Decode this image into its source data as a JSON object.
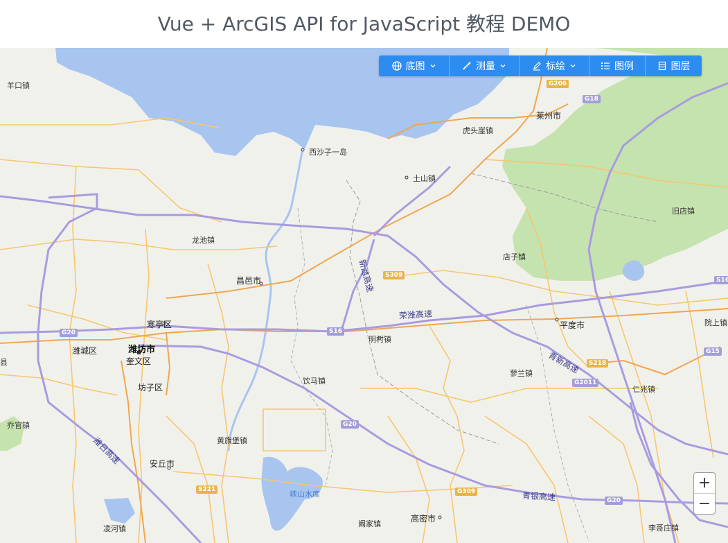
{
  "header": {
    "title": "Vue + ArcGIS API for JavaScript 教程 DEMO"
  },
  "toolbar": {
    "items": [
      {
        "label": "底图",
        "icon": "globe-icon",
        "dropdown": true
      },
      {
        "label": "测量",
        "icon": "ruler-icon",
        "dropdown": true
      },
      {
        "label": "标绘",
        "icon": "pen-icon",
        "dropdown": true
      },
      {
        "label": "图例",
        "icon": "list-icon",
        "dropdown": false
      },
      {
        "label": "图层",
        "icon": "layers-icon",
        "dropdown": false
      }
    ],
    "color": "#2d8cf0"
  },
  "zoom": {
    "in": "+",
    "out": "−"
  },
  "map": {
    "colors": {
      "land": "#f1f1ec",
      "water": "#a8c5ef",
      "forest": "#c5e3ae",
      "highway": "#a99be0",
      "road": "#f7c66f"
    },
    "places": [
      "羊口镇",
      "西沙子一岛",
      "土山镇",
      "虎头崖镇",
      "莱州市",
      "旧店镇",
      "龙池镇",
      "店子镇",
      "昌邑市",
      "寒亭区",
      "潍坊市",
      "潍城区",
      "奎文区",
      "坊子区",
      "明村镇",
      "平度市",
      "院上镇",
      "饮马镇",
      "蓼兰镇",
      "仁兆镇",
      "乔官镇",
      "黄旗堡镇",
      "安丘市",
      "凌河镇",
      "阚家镇",
      "高密市",
      "李哥庄镇",
      "县"
    ],
    "roads": [
      "新潍高速",
      "荣潍高速",
      "青新高速",
      "潍日高速",
      "青银高速"
    ],
    "water_labels": [
      "峡山水库"
    ],
    "shields": [
      "G206",
      "G18",
      "S309",
      "S16",
      "G20",
      "S218",
      "G2011",
      "G15",
      "S16",
      "S221",
      "G309",
      "G20",
      "G20"
    ]
  }
}
